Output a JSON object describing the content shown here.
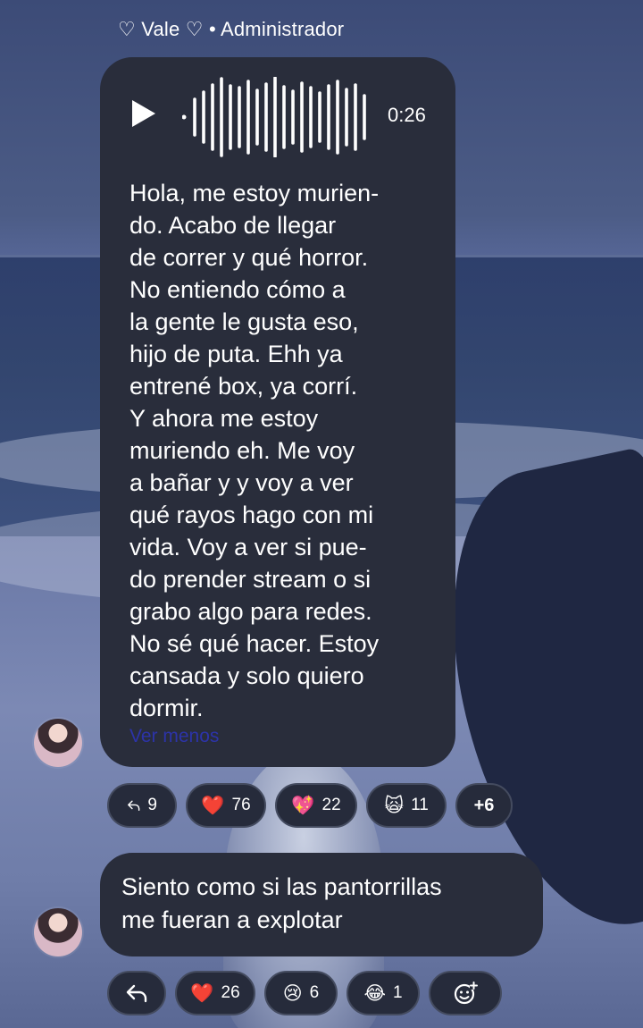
{
  "message1": {
    "sender": "♡ Vale ♡ • Administrador",
    "voice": {
      "duration": "0:26",
      "transcript": "Hola, me estoy murien-\ndo. Acabo de llegar\nde correr y qué horror.\nNo entiendo cómo a\nla gente le gusta eso,\nhijo de puta. Ehh ya\nentrené box, ya corrí.\nY ahora me estoy\nmuriendo eh. Me voy\na bañar y y voy a ver\nqué rayos hago con mi\nvida. Voy a ver si pue-\ndo prender stream o si\ngrabo algo para redes.\nNo sé qué hacer. Estoy\ncansada y solo quiero\ndormir.",
      "toggle_label": "Ver menos"
    },
    "reactions": [
      {
        "icon": "reply-icon",
        "count": "9"
      },
      {
        "emoji": "❤️",
        "icon": "heart-icon",
        "count": "76"
      },
      {
        "emoji": "💖",
        "icon": "sparkling-heart-icon",
        "count": "22"
      },
      {
        "emoji": "🙀",
        "icon": "weary-cat-icon",
        "count": "11"
      },
      {
        "label": "+6"
      }
    ]
  },
  "message2": {
    "text": "Siento como si las pantorrillas\nme fueran a explotar",
    "reactions": [
      {
        "icon": "reply-icon"
      },
      {
        "emoji": "❤️",
        "icon": "heart-icon",
        "count": "26"
      },
      {
        "emoji": "😢",
        "icon": "crying-face-icon",
        "count": "6"
      },
      {
        "emoji": "😂",
        "icon": "tears-of-joy-icon",
        "count": "1"
      },
      {
        "icon": "add-reaction-icon"
      }
    ]
  }
}
